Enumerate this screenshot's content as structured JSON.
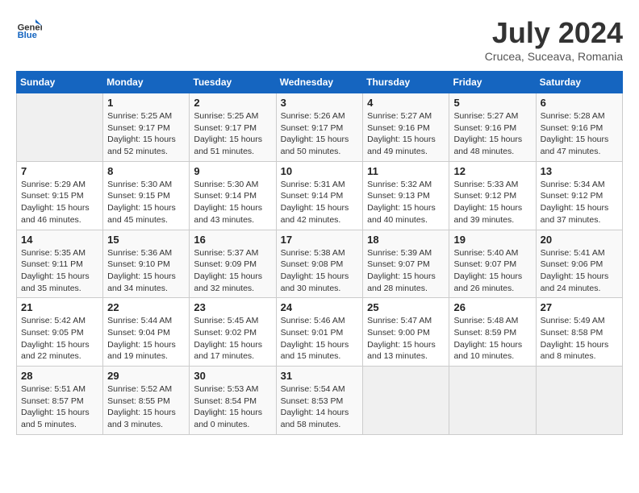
{
  "header": {
    "logo_general": "General",
    "logo_blue": "Blue",
    "month": "July 2024",
    "location": "Crucea, Suceava, Romania"
  },
  "columns": [
    "Sunday",
    "Monday",
    "Tuesday",
    "Wednesday",
    "Thursday",
    "Friday",
    "Saturday"
  ],
  "weeks": [
    [
      {
        "day": "",
        "info": ""
      },
      {
        "day": "1",
        "info": "Sunrise: 5:25 AM\nSunset: 9:17 PM\nDaylight: 15 hours\nand 52 minutes."
      },
      {
        "day": "2",
        "info": "Sunrise: 5:25 AM\nSunset: 9:17 PM\nDaylight: 15 hours\nand 51 minutes."
      },
      {
        "day": "3",
        "info": "Sunrise: 5:26 AM\nSunset: 9:17 PM\nDaylight: 15 hours\nand 50 minutes."
      },
      {
        "day": "4",
        "info": "Sunrise: 5:27 AM\nSunset: 9:16 PM\nDaylight: 15 hours\nand 49 minutes."
      },
      {
        "day": "5",
        "info": "Sunrise: 5:27 AM\nSunset: 9:16 PM\nDaylight: 15 hours\nand 48 minutes."
      },
      {
        "day": "6",
        "info": "Sunrise: 5:28 AM\nSunset: 9:16 PM\nDaylight: 15 hours\nand 47 minutes."
      }
    ],
    [
      {
        "day": "7",
        "info": "Sunrise: 5:29 AM\nSunset: 9:15 PM\nDaylight: 15 hours\nand 46 minutes."
      },
      {
        "day": "8",
        "info": "Sunrise: 5:30 AM\nSunset: 9:15 PM\nDaylight: 15 hours\nand 45 minutes."
      },
      {
        "day": "9",
        "info": "Sunrise: 5:30 AM\nSunset: 9:14 PM\nDaylight: 15 hours\nand 43 minutes."
      },
      {
        "day": "10",
        "info": "Sunrise: 5:31 AM\nSunset: 9:14 PM\nDaylight: 15 hours\nand 42 minutes."
      },
      {
        "day": "11",
        "info": "Sunrise: 5:32 AM\nSunset: 9:13 PM\nDaylight: 15 hours\nand 40 minutes."
      },
      {
        "day": "12",
        "info": "Sunrise: 5:33 AM\nSunset: 9:12 PM\nDaylight: 15 hours\nand 39 minutes."
      },
      {
        "day": "13",
        "info": "Sunrise: 5:34 AM\nSunset: 9:12 PM\nDaylight: 15 hours\nand 37 minutes."
      }
    ],
    [
      {
        "day": "14",
        "info": "Sunrise: 5:35 AM\nSunset: 9:11 PM\nDaylight: 15 hours\nand 35 minutes."
      },
      {
        "day": "15",
        "info": "Sunrise: 5:36 AM\nSunset: 9:10 PM\nDaylight: 15 hours\nand 34 minutes."
      },
      {
        "day": "16",
        "info": "Sunrise: 5:37 AM\nSunset: 9:09 PM\nDaylight: 15 hours\nand 32 minutes."
      },
      {
        "day": "17",
        "info": "Sunrise: 5:38 AM\nSunset: 9:08 PM\nDaylight: 15 hours\nand 30 minutes."
      },
      {
        "day": "18",
        "info": "Sunrise: 5:39 AM\nSunset: 9:07 PM\nDaylight: 15 hours\nand 28 minutes."
      },
      {
        "day": "19",
        "info": "Sunrise: 5:40 AM\nSunset: 9:07 PM\nDaylight: 15 hours\nand 26 minutes."
      },
      {
        "day": "20",
        "info": "Sunrise: 5:41 AM\nSunset: 9:06 PM\nDaylight: 15 hours\nand 24 minutes."
      }
    ],
    [
      {
        "day": "21",
        "info": "Sunrise: 5:42 AM\nSunset: 9:05 PM\nDaylight: 15 hours\nand 22 minutes."
      },
      {
        "day": "22",
        "info": "Sunrise: 5:44 AM\nSunset: 9:04 PM\nDaylight: 15 hours\nand 19 minutes."
      },
      {
        "day": "23",
        "info": "Sunrise: 5:45 AM\nSunset: 9:02 PM\nDaylight: 15 hours\nand 17 minutes."
      },
      {
        "day": "24",
        "info": "Sunrise: 5:46 AM\nSunset: 9:01 PM\nDaylight: 15 hours\nand 15 minutes."
      },
      {
        "day": "25",
        "info": "Sunrise: 5:47 AM\nSunset: 9:00 PM\nDaylight: 15 hours\nand 13 minutes."
      },
      {
        "day": "26",
        "info": "Sunrise: 5:48 AM\nSunset: 8:59 PM\nDaylight: 15 hours\nand 10 minutes."
      },
      {
        "day": "27",
        "info": "Sunrise: 5:49 AM\nSunset: 8:58 PM\nDaylight: 15 hours\nand 8 minutes."
      }
    ],
    [
      {
        "day": "28",
        "info": "Sunrise: 5:51 AM\nSunset: 8:57 PM\nDaylight: 15 hours\nand 5 minutes."
      },
      {
        "day": "29",
        "info": "Sunrise: 5:52 AM\nSunset: 8:55 PM\nDaylight: 15 hours\nand 3 minutes."
      },
      {
        "day": "30",
        "info": "Sunrise: 5:53 AM\nSunset: 8:54 PM\nDaylight: 15 hours\nand 0 minutes."
      },
      {
        "day": "31",
        "info": "Sunrise: 5:54 AM\nSunset: 8:53 PM\nDaylight: 14 hours\nand 58 minutes."
      },
      {
        "day": "",
        "info": ""
      },
      {
        "day": "",
        "info": ""
      },
      {
        "day": "",
        "info": ""
      }
    ]
  ]
}
